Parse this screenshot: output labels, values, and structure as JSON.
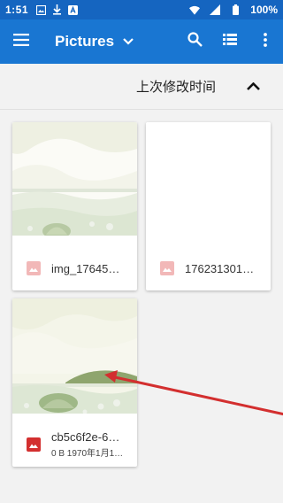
{
  "status_bar": {
    "time": "1:51",
    "battery": "100%"
  },
  "app_bar": {
    "title": "Pictures"
  },
  "sort_bar": {
    "label": "上次修改时间"
  },
  "files": [
    {
      "name": "img_17645…",
      "meta": ""
    },
    {
      "name": "176231301…",
      "meta": ""
    },
    {
      "name": "cb5c6f2e-6…",
      "meta": "0 B 1970年1月1…"
    }
  ],
  "colors": {
    "status_bar": "#1565c0",
    "app_bar": "#1976d2",
    "image_icon_muted": "#f2b8b8",
    "image_icon_active": "#d32f2f",
    "annotation_arrow": "#d32f2f"
  },
  "icons": {
    "menu": "menu-icon",
    "dropdown": "chevron-down-icon",
    "search": "search-icon",
    "list_view": "list-view-icon",
    "more": "more-vert-icon",
    "sort": "chevron-up-icon",
    "file": "image-file-icon"
  }
}
